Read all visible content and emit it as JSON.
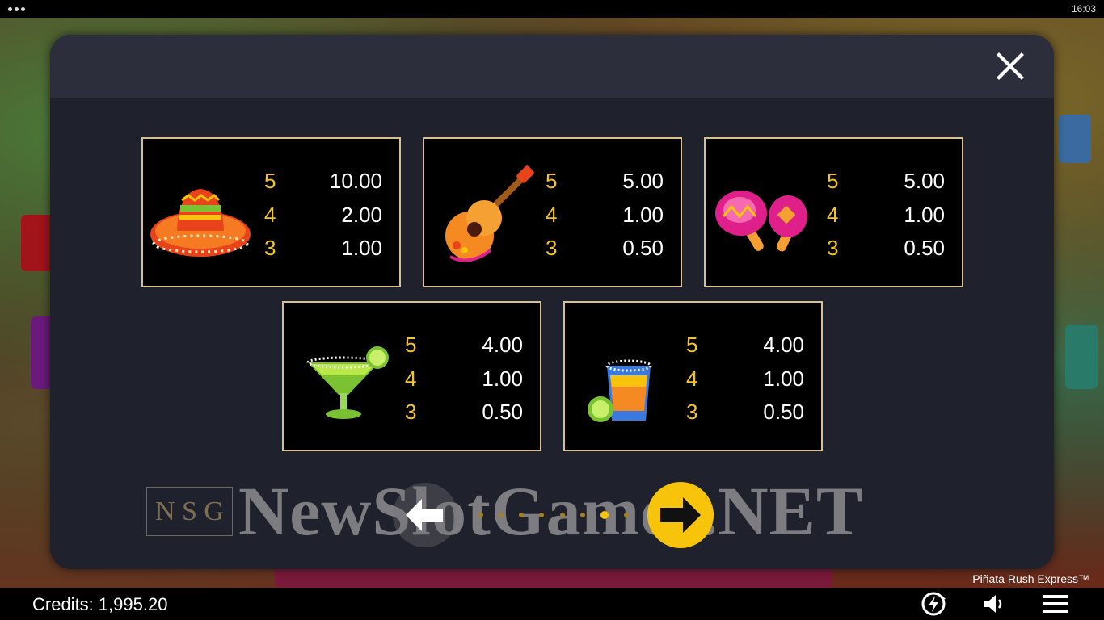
{
  "status_bar": {
    "time": "16:03"
  },
  "paytable": {
    "symbols": [
      {
        "name": "sombrero",
        "pays": [
          {
            "count": "5",
            "value": "10.00"
          },
          {
            "count": "4",
            "value": "2.00"
          },
          {
            "count": "3",
            "value": "1.00"
          }
        ]
      },
      {
        "name": "guitar",
        "pays": [
          {
            "count": "5",
            "value": "5.00"
          },
          {
            "count": "4",
            "value": "1.00"
          },
          {
            "count": "3",
            "value": "0.50"
          }
        ]
      },
      {
        "name": "maracas",
        "pays": [
          {
            "count": "5",
            "value": "5.00"
          },
          {
            "count": "4",
            "value": "1.00"
          },
          {
            "count": "3",
            "value": "0.50"
          }
        ]
      },
      {
        "name": "margarita",
        "pays": [
          {
            "count": "5",
            "value": "4.00"
          },
          {
            "count": "4",
            "value": "1.00"
          },
          {
            "count": "3",
            "value": "0.50"
          }
        ]
      },
      {
        "name": "tequila-shot",
        "pays": [
          {
            "count": "5",
            "value": "4.00"
          },
          {
            "count": "4",
            "value": "1.00"
          },
          {
            "count": "3",
            "value": "0.50"
          }
        ]
      }
    ],
    "pages": {
      "total": 8,
      "current": 7
    }
  },
  "watermark": {
    "logo_letters": [
      "N",
      "S",
      "G"
    ],
    "text": "NewSlotGames.NET"
  },
  "game_title": "Piñata Rush Express™",
  "credits": {
    "label": "Credits:",
    "value": "1,995.20"
  },
  "colors": {
    "accent": "#f8c40b",
    "card_border": "#d7c08e",
    "pay_count": "#f4c32a",
    "modal_bg": "#1f212c"
  }
}
